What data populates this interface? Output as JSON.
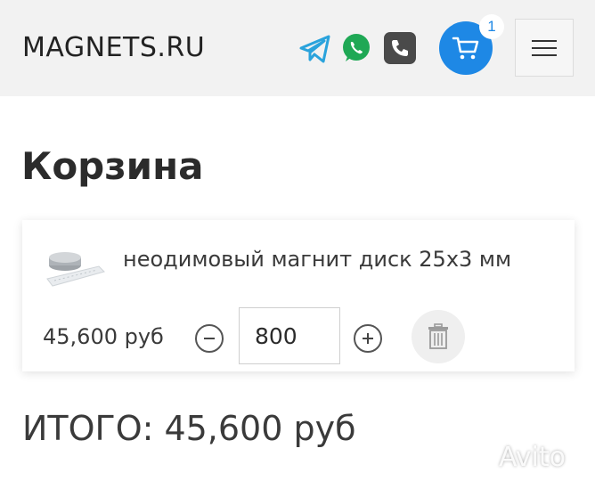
{
  "header": {
    "logo": "MAGNETS.RU",
    "icons": {
      "telegram": "telegram-icon",
      "whatsapp": "whatsapp-icon",
      "phone": "phone-icon",
      "cart": "cart-icon",
      "menu": "hamburger-menu-icon"
    },
    "cart_count": "1"
  },
  "page": {
    "title": "Корзина"
  },
  "cart": {
    "items": [
      {
        "name": "неодимовый магнит диск 25x3 мм",
        "price": "45,600 руб",
        "quantity": "800"
      }
    ]
  },
  "total": {
    "label": "ИТОГО:",
    "value": "45,600 руб"
  },
  "watermark": "Avito",
  "colors": {
    "accent": "#1e88e5",
    "telegram": "#2aa3dc",
    "whatsapp": "#1fa855",
    "header_bg": "#f2f2f2"
  }
}
